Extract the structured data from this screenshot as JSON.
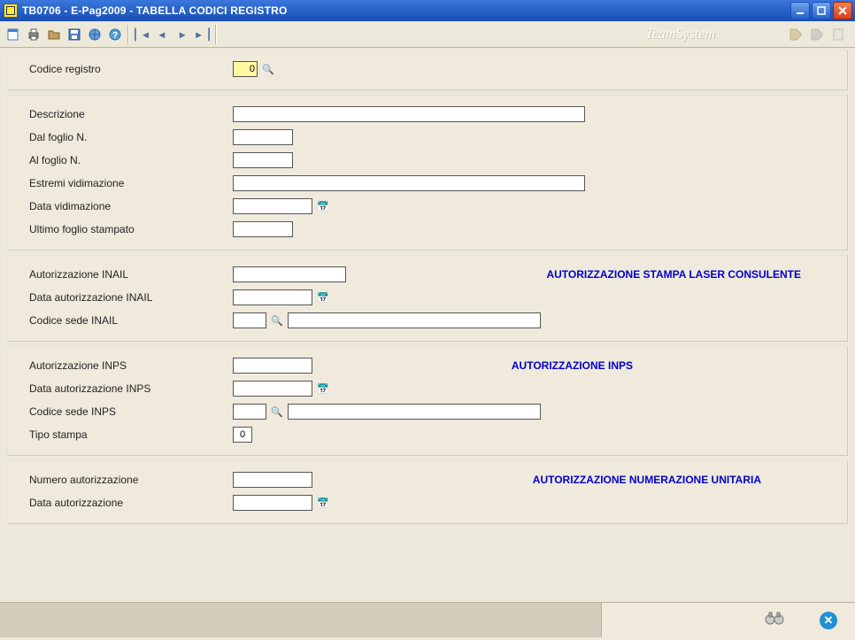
{
  "window": {
    "title": "TB0706  - E-Pag2009  -  TABELLA CODICI REGISTRO"
  },
  "brand": "TeamSystem",
  "panel1": {
    "codice_registro_label": "Codice registro",
    "codice_registro_value": "0"
  },
  "panel2": {
    "descrizione_label": "Descrizione",
    "dal_foglio_label": "Dal foglio N.",
    "al_foglio_label": "Al  foglio N.",
    "estremi_label": "Estremi vidimazione",
    "data_vid_label": "Data vidimazione",
    "ultimo_foglio_label": "Ultimo foglio stampato"
  },
  "panel3": {
    "autor_inail_label": "Autorizzazione INAIL",
    "data_autor_inail_label": "Data autorizzazione INAIL",
    "codice_sede_inail_label": "Codice sede INAIL",
    "heading": "AUTORIZZAZIONE STAMPA LASER CONSULENTE"
  },
  "panel4": {
    "autor_inps_label": "Autorizzazione INPS",
    "data_autor_inps_label": "Data autorizzazione INPS",
    "codice_sede_inps_label": "Codice sede INPS",
    "tipo_stampa_label": "Tipo stampa",
    "tipo_stampa_value": "0",
    "heading": "AUTORIZZAZIONE INPS"
  },
  "panel5": {
    "numero_autor_label": "Numero autorizzazione",
    "data_autor_label": "Data autorizzazione",
    "heading": "AUTORIZZAZIONE NUMERAZIONE UNITARIA"
  }
}
